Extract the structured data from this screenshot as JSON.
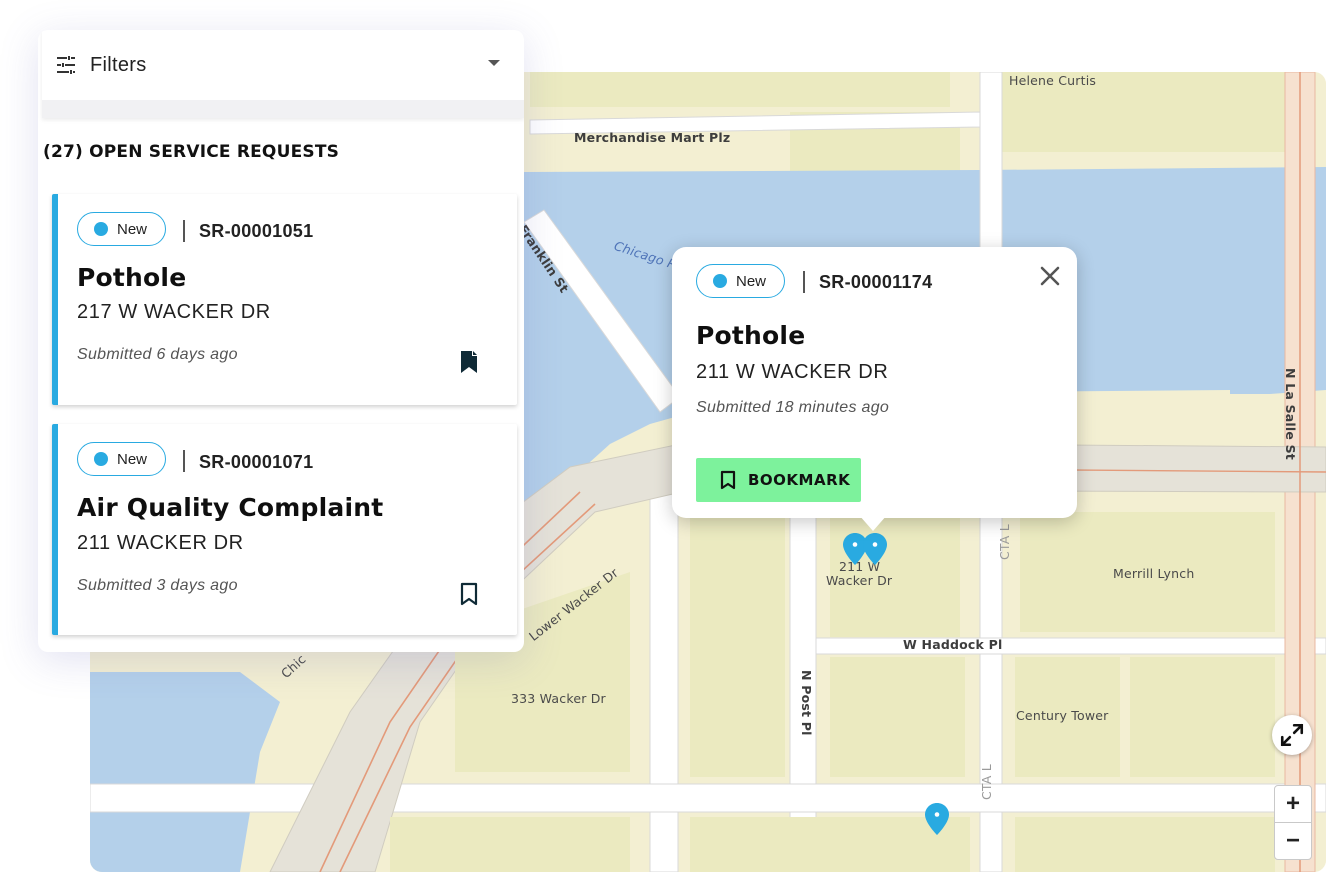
{
  "filters": {
    "icon": "tune-icon",
    "label": "Filters"
  },
  "list": {
    "heading": "(27) OPEN SERVICE REQUESTS",
    "requests": [
      {
        "status": "New",
        "id": "SR-00001051",
        "title": "Pothole",
        "address": "217 W WACKER DR",
        "submitted": "Submitted 6 days ago",
        "bookmark_icon": "bookmark-filled-icon"
      },
      {
        "status": "New",
        "id": "SR-00001071",
        "title": "Air Quality Complaint",
        "address": "211 WACKER DR",
        "submitted": "Submitted 3 days ago",
        "bookmark_icon": "bookmark-outline-icon"
      }
    ]
  },
  "popup": {
    "status": "New",
    "id": "SR-00001174",
    "title": "Pothole",
    "address": "211 W WACKER DR",
    "submitted": "Submitted 18 minutes ago",
    "bookmark_label": "BOOKMARK"
  },
  "map": {
    "labels": {
      "helene_curtis": "Helene Curtis",
      "merchandise_mart": "Merchandise Mart Plz",
      "franklin": "Franklin St",
      "chicago_river": "Chicago R",
      "la_salle": "N La Salle St",
      "wacker_211_a": "211 W",
      "wacker_211_b": "Wacker Dr",
      "merrill": "Merrill Lynch",
      "haddock": "W Haddock Pl",
      "post_pl": "N Post Pl",
      "cta_1": "CTA L",
      "cta_2": "CTA L",
      "lower_wacker": "Lower Wacker Dr",
      "wacker_333": "333 Wacker Dr",
      "century": "Century Tower",
      "chic": "Chic"
    },
    "zoom_in": "+",
    "zoom_out": "−",
    "expand_icon": "expand-icon"
  },
  "colors": {
    "accent": "#29aae1",
    "bookmark_button": "#7df29c",
    "water": "#b4d0ea",
    "block": "#ebeac0",
    "land": "#f3efd2"
  }
}
